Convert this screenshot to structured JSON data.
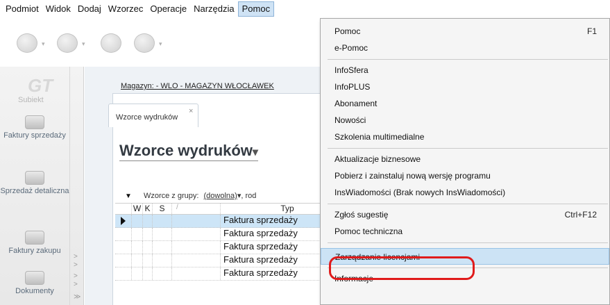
{
  "menubar": {
    "items": [
      {
        "label": "Podmiot",
        "key": "podmiot"
      },
      {
        "label": "Widok",
        "key": "widok"
      },
      {
        "label": "Dodaj",
        "key": "dodaj"
      },
      {
        "label": "Wzorzec",
        "key": "wzorzec"
      },
      {
        "label": "Operacje",
        "key": "operacje"
      },
      {
        "label": "Narzędzia",
        "key": "narzedzia"
      },
      {
        "label": "Pomoc",
        "key": "pomoc",
        "active": true
      }
    ]
  },
  "sidebar": {
    "logo_text": "GT",
    "logo_sub": "Subiekt",
    "items": [
      {
        "label": "Faktury sprzedaży"
      },
      {
        "label": "Sprzedaż detaliczna"
      },
      {
        "label": "Faktury zakupu"
      },
      {
        "label": "Dokumenty"
      }
    ]
  },
  "main": {
    "magazyn": "Magazyn: - WLO - MAGAZYN WŁOCŁAWEK",
    "tab_label": "Wzorce wydruków",
    "tab_close": "×",
    "title": "Wzorce wydruków",
    "filter": {
      "label": "Wzorce z grupy:",
      "group": "(dowolna)",
      "rest": ", rod"
    },
    "grid": {
      "columns": [
        "W",
        "K",
        "S",
        "Typ"
      ],
      "rows": [
        {
          "typ": "Faktura sprzedaży",
          "selected": true
        },
        {
          "typ": "Faktura sprzedaży"
        },
        {
          "typ": "Faktura sprzedaży"
        },
        {
          "typ": "Faktura sprzedaży"
        },
        {
          "typ": "Faktura sprzedaży"
        }
      ]
    }
  },
  "dropdown": {
    "items": [
      {
        "label": "Pomoc",
        "shortcut": "F1"
      },
      {
        "label": "e-Pomoc"
      },
      {
        "label": "InfoSfera"
      },
      {
        "label": "InfoPLUS"
      },
      {
        "label": "Abonament"
      },
      {
        "label": "Nowości"
      },
      {
        "label": "Szkolenia multimedialne"
      },
      {
        "label": "Aktualizacje biznesowe"
      },
      {
        "label": "Pobierz i zainstaluj nową wersję programu"
      },
      {
        "label": "InsWiadomości (Brak nowych InsWiadomości)"
      },
      {
        "label": "Zgłoś sugestię",
        "shortcut": "Ctrl+F12"
      },
      {
        "label": "Pomoc techniczna"
      },
      {
        "label": "Zarządzanie licencjami",
        "highlighted": true
      },
      {
        "label": "Informacje"
      }
    ]
  },
  "colors": {
    "highlight": "#cce3f5",
    "annotation_ring": "#e01b1b",
    "selected_row": "#cde5f7"
  }
}
